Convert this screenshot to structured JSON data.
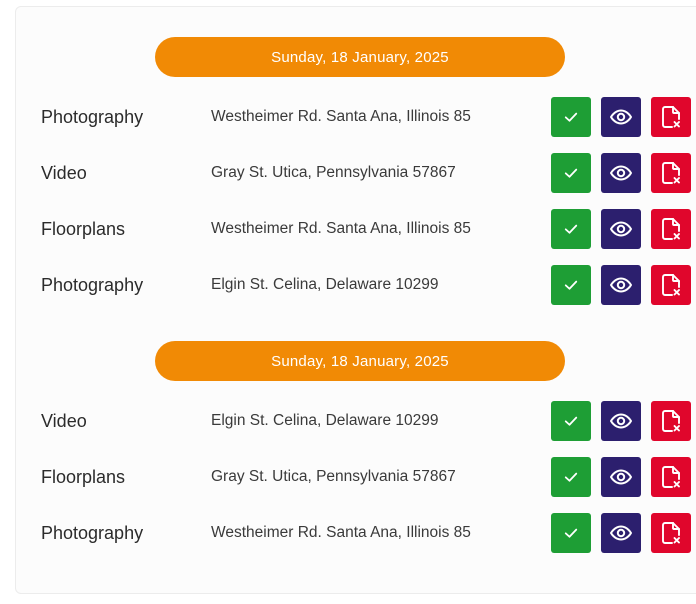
{
  "colors": {
    "date_pill": "#f18a05",
    "approve": "#1e9e35",
    "view": "#2c1f6e",
    "delete": "#e0062c"
  },
  "icons": {
    "approve": "check-icon",
    "view": "eye-icon",
    "delete": "file-remove-icon"
  },
  "groups": [
    {
      "date": "Sunday, 18 January, 2025",
      "rows": [
        {
          "service": "Photography",
          "address": "Westheimer Rd. Santa Ana, Illinois 85"
        },
        {
          "service": "Video",
          "address": "Gray St. Utica, Pennsylvania 57867"
        },
        {
          "service": "Floorplans",
          "address": "Westheimer Rd. Santa Ana, Illinois 85"
        },
        {
          "service": "Photography",
          "address": "Elgin St. Celina, Delaware 10299"
        }
      ]
    },
    {
      "date": "Sunday, 18 January, 2025",
      "rows": [
        {
          "service": "Video",
          "address": "Elgin St. Celina, Delaware 10299"
        },
        {
          "service": "Floorplans",
          "address": "Gray St. Utica, Pennsylvania 57867"
        },
        {
          "service": "Photography",
          "address": "Westheimer Rd. Santa Ana, Illinois 85"
        }
      ]
    }
  ]
}
